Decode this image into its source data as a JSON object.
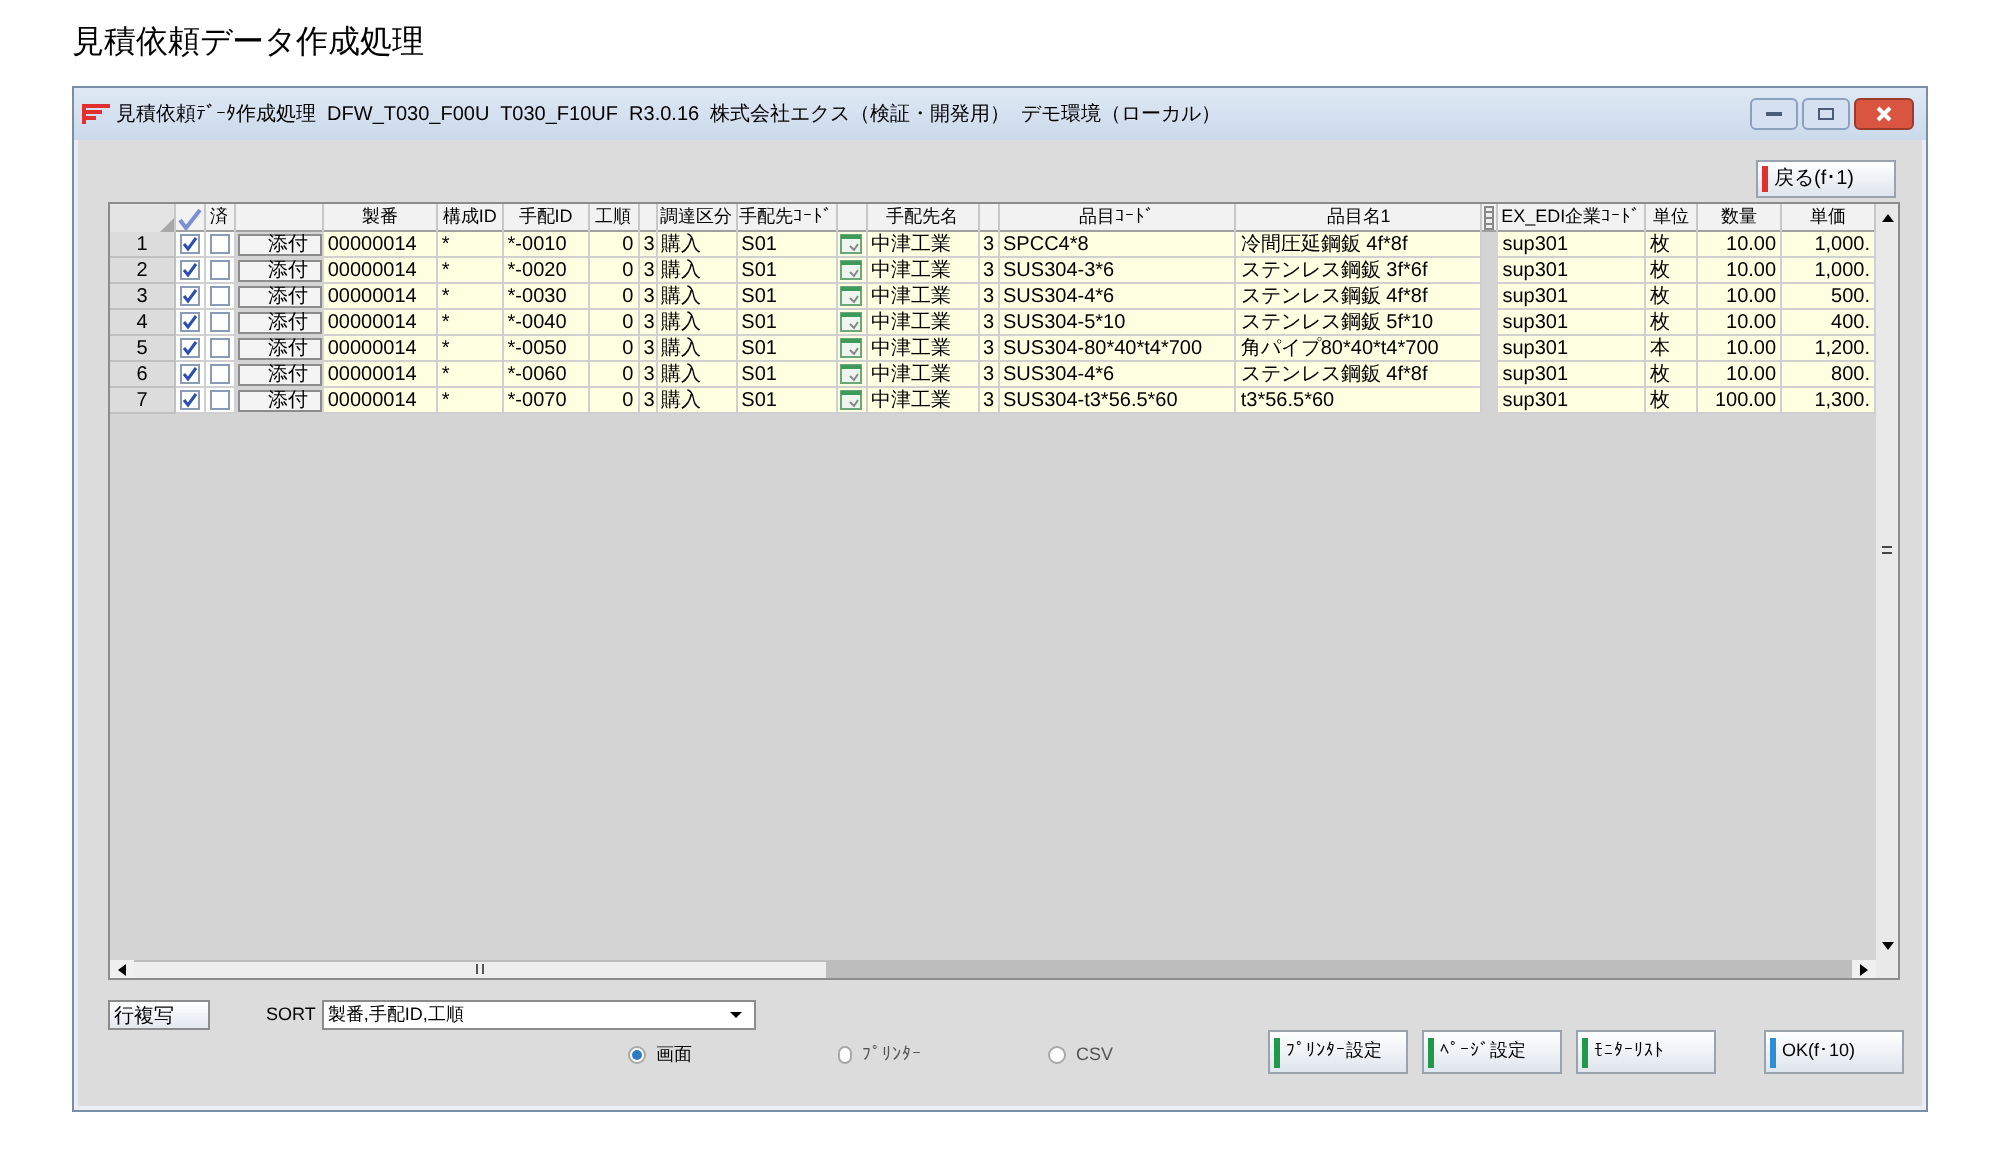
{
  "page_title": "見積依頼データ作成処理",
  "window": {
    "title": "見積依頼ﾃﾞｰﾀ作成処理  DFW_T030_F00U  T030_F10UF  R3.0.16  株式会社エクス（検証・開発用）  デモ環境（ローカル）"
  },
  "back_button": "戻る(f･1)",
  "table": {
    "columns": [
      {
        "kind": "check_all"
      },
      {
        "kind": "text",
        "label": "済"
      },
      {
        "kind": "blank"
      },
      {
        "kind": "text",
        "label": "製番"
      },
      {
        "kind": "text",
        "label": "構成ID"
      },
      {
        "kind": "text",
        "label": "手配ID"
      },
      {
        "kind": "text",
        "label": "工順"
      },
      {
        "kind": "blank"
      },
      {
        "kind": "text",
        "label": "調達区分"
      },
      {
        "kind": "text",
        "label": "手配先ｺｰﾄﾞ"
      },
      {
        "kind": "blank"
      },
      {
        "kind": "text",
        "label": "手配先名"
      },
      {
        "kind": "blank"
      },
      {
        "kind": "text",
        "label": "品目ｺｰﾄﾞ"
      },
      {
        "kind": "text",
        "label": "品目名1"
      },
      {
        "kind": "grip"
      },
      {
        "kind": "text",
        "label": "EX_EDI企業ｺｰﾄﾞ"
      },
      {
        "kind": "text",
        "label": "単位"
      },
      {
        "kind": "text",
        "label": "数量"
      },
      {
        "kind": "text",
        "label": "単価"
      }
    ],
    "rows": [
      {
        "number": "1",
        "cells": [
          {
            "kind": "check",
            "checked": true
          },
          {
            "kind": "check",
            "checked": false
          },
          {
            "kind": "button",
            "text": "添付"
          },
          {
            "kind": "text",
            "text": "00000014"
          },
          {
            "kind": "text",
            "text": "*"
          },
          {
            "kind": "text",
            "text": "*-0010"
          },
          {
            "kind": "text",
            "text": "0"
          },
          {
            "kind": "text",
            "text": "3"
          },
          {
            "kind": "text",
            "text": "購入"
          },
          {
            "kind": "text",
            "text": "S01"
          },
          {
            "kind": "icon"
          },
          {
            "kind": "text",
            "text": "中津工業"
          },
          {
            "kind": "text",
            "text": "3"
          },
          {
            "kind": "text",
            "text": "SPCC4*8"
          },
          {
            "kind": "text",
            "text": "冷間圧延鋼鈑 4f*8f"
          },
          {
            "kind": "blank"
          },
          {
            "kind": "text",
            "text": "sup301"
          },
          {
            "kind": "text",
            "text": "枚"
          },
          {
            "kind": "text",
            "text": "10.00"
          },
          {
            "kind": "text",
            "text": "1,000."
          }
        ]
      },
      {
        "number": "2",
        "cells": [
          {
            "kind": "check",
            "checked": true
          },
          {
            "kind": "check",
            "checked": false
          },
          {
            "kind": "button",
            "text": "添付"
          },
          {
            "kind": "text",
            "text": "00000014"
          },
          {
            "kind": "text",
            "text": "*"
          },
          {
            "kind": "text",
            "text": "*-0020"
          },
          {
            "kind": "text",
            "text": "0"
          },
          {
            "kind": "text",
            "text": "3"
          },
          {
            "kind": "text",
            "text": "購入"
          },
          {
            "kind": "text",
            "text": "S01"
          },
          {
            "kind": "icon"
          },
          {
            "kind": "text",
            "text": "中津工業"
          },
          {
            "kind": "text",
            "text": "3"
          },
          {
            "kind": "text",
            "text": "SUS304-3*6"
          },
          {
            "kind": "text",
            "text": "ステンレス鋼鈑 3f*6f"
          },
          {
            "kind": "blank"
          },
          {
            "kind": "text",
            "text": "sup301"
          },
          {
            "kind": "text",
            "text": "枚"
          },
          {
            "kind": "text",
            "text": "10.00"
          },
          {
            "kind": "text",
            "text": "1,000."
          }
        ]
      },
      {
        "number": "3",
        "cells": [
          {
            "kind": "check",
            "checked": true
          },
          {
            "kind": "check",
            "checked": false
          },
          {
            "kind": "button",
            "text": "添付"
          },
          {
            "kind": "text",
            "text": "00000014"
          },
          {
            "kind": "text",
            "text": "*"
          },
          {
            "kind": "text",
            "text": "*-0030"
          },
          {
            "kind": "text",
            "text": "0"
          },
          {
            "kind": "text",
            "text": "3"
          },
          {
            "kind": "text",
            "text": "購入"
          },
          {
            "kind": "text",
            "text": "S01"
          },
          {
            "kind": "icon"
          },
          {
            "kind": "text",
            "text": "中津工業"
          },
          {
            "kind": "text",
            "text": "3"
          },
          {
            "kind": "text",
            "text": "SUS304-4*6"
          },
          {
            "kind": "text",
            "text": "ステンレス鋼鈑 4f*8f"
          },
          {
            "kind": "blank"
          },
          {
            "kind": "text",
            "text": "sup301"
          },
          {
            "kind": "text",
            "text": "枚"
          },
          {
            "kind": "text",
            "text": "10.00"
          },
          {
            "kind": "text",
            "text": "500."
          }
        ]
      },
      {
        "number": "4",
        "cells": [
          {
            "kind": "check",
            "checked": true
          },
          {
            "kind": "check",
            "checked": false
          },
          {
            "kind": "button",
            "text": "添付"
          },
          {
            "kind": "text",
            "text": "00000014"
          },
          {
            "kind": "text",
            "text": "*"
          },
          {
            "kind": "text",
            "text": "*-0040"
          },
          {
            "kind": "text",
            "text": "0"
          },
          {
            "kind": "text",
            "text": "3"
          },
          {
            "kind": "text",
            "text": "購入"
          },
          {
            "kind": "text",
            "text": "S01"
          },
          {
            "kind": "icon"
          },
          {
            "kind": "text",
            "text": "中津工業"
          },
          {
            "kind": "text",
            "text": "3"
          },
          {
            "kind": "text",
            "text": "SUS304-5*10"
          },
          {
            "kind": "text",
            "text": "ステンレス鋼鈑 5f*10"
          },
          {
            "kind": "blank"
          },
          {
            "kind": "text",
            "text": "sup301"
          },
          {
            "kind": "text",
            "text": "枚"
          },
          {
            "kind": "text",
            "text": "10.00"
          },
          {
            "kind": "text",
            "text": "400."
          }
        ]
      },
      {
        "number": "5",
        "cells": [
          {
            "kind": "check",
            "checked": true
          },
          {
            "kind": "check",
            "checked": false
          },
          {
            "kind": "button",
            "text": "添付"
          },
          {
            "kind": "text",
            "text": "00000014"
          },
          {
            "kind": "text",
            "text": "*"
          },
          {
            "kind": "text",
            "text": "*-0050"
          },
          {
            "kind": "text",
            "text": "0"
          },
          {
            "kind": "text",
            "text": "3"
          },
          {
            "kind": "text",
            "text": "購入"
          },
          {
            "kind": "text",
            "text": "S01"
          },
          {
            "kind": "icon"
          },
          {
            "kind": "text",
            "text": "中津工業"
          },
          {
            "kind": "text",
            "text": "3"
          },
          {
            "kind": "text",
            "text": "SUS304-80*40*t4*700"
          },
          {
            "kind": "text",
            "text": "角パイプ80*40*t4*700"
          },
          {
            "kind": "blank"
          },
          {
            "kind": "text",
            "text": "sup301"
          },
          {
            "kind": "text",
            "text": "本"
          },
          {
            "kind": "text",
            "text": "10.00"
          },
          {
            "kind": "text",
            "text": "1,200."
          }
        ]
      },
      {
        "number": "6",
        "cells": [
          {
            "kind": "check",
            "checked": true
          },
          {
            "kind": "check",
            "checked": false
          },
          {
            "kind": "button",
            "text": "添付"
          },
          {
            "kind": "text",
            "text": "00000014"
          },
          {
            "kind": "text",
            "text": "*"
          },
          {
            "kind": "text",
            "text": "*-0060"
          },
          {
            "kind": "text",
            "text": "0"
          },
          {
            "kind": "text",
            "text": "3"
          },
          {
            "kind": "text",
            "text": "購入"
          },
          {
            "kind": "text",
            "text": "S01"
          },
          {
            "kind": "icon"
          },
          {
            "kind": "text",
            "text": "中津工業"
          },
          {
            "kind": "text",
            "text": "3"
          },
          {
            "kind": "text",
            "text": "SUS304-4*6"
          },
          {
            "kind": "text",
            "text": "ステンレス鋼鈑 4f*8f"
          },
          {
            "kind": "blank"
          },
          {
            "kind": "text",
            "text": "sup301"
          },
          {
            "kind": "text",
            "text": "枚"
          },
          {
            "kind": "text",
            "text": "10.00"
          },
          {
            "kind": "text",
            "text": "800."
          }
        ]
      },
      {
        "number": "7",
        "cells": [
          {
            "kind": "check",
            "checked": true
          },
          {
            "kind": "check",
            "checked": false
          },
          {
            "kind": "button",
            "text": "添付"
          },
          {
            "kind": "text",
            "text": "00000014"
          },
          {
            "kind": "text",
            "text": "*"
          },
          {
            "kind": "text",
            "text": "*-0070"
          },
          {
            "kind": "text",
            "text": "0"
          },
          {
            "kind": "text",
            "text": "3"
          },
          {
            "kind": "text",
            "text": "購入"
          },
          {
            "kind": "text",
            "text": "S01"
          },
          {
            "kind": "icon"
          },
          {
            "kind": "text",
            "text": "中津工業"
          },
          {
            "kind": "text",
            "text": "3"
          },
          {
            "kind": "text",
            "text": "SUS304-t3*56.5*60"
          },
          {
            "kind": "text",
            "text": "t3*56.5*60"
          },
          {
            "kind": "blank"
          },
          {
            "kind": "text",
            "text": "sup301"
          },
          {
            "kind": "text",
            "text": "枚"
          },
          {
            "kind": "text",
            "text": "100.00"
          },
          {
            "kind": "text",
            "text": "1,300."
          }
        ]
      }
    ]
  },
  "copy_row_button": "行複写",
  "sort": {
    "label": "SORT",
    "value": "製番,手配ID,工順"
  },
  "output_options": [
    {
      "label": "画面",
      "selected": true
    },
    {
      "label": "ﾌﾟﾘﾝﾀｰ",
      "selected": false
    },
    {
      "label": "CSV",
      "selected": false
    }
  ],
  "buttons": [
    {
      "label": "ﾌﾟﾘﾝﾀｰ設定",
      "color": "#1e9a4a"
    },
    {
      "label": "ﾍﾟｰｼﾞ設定",
      "color": "#1e9a4a"
    },
    {
      "label": "ﾓﾆﾀｰﾘｽﾄ",
      "color": "#1e9a4a"
    },
    {
      "label": "OK(f･10)",
      "color": "#2a8fd6"
    }
  ]
}
